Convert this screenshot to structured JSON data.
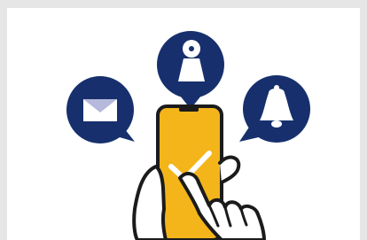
{
  "illustration": {
    "icons": {
      "mail": "mail-icon",
      "user": "user-icon",
      "bell": "bell-icon",
      "check": "check-icon"
    },
    "colors": {
      "frame": "#e6e6e6",
      "background": "#ffffff",
      "badge_navy": "#17306d",
      "phone_yellow": "#f3b51a",
      "outline": "#1b1b1b",
      "white": "#ffffff",
      "mail_flap": "#b6b8dc"
    }
  }
}
